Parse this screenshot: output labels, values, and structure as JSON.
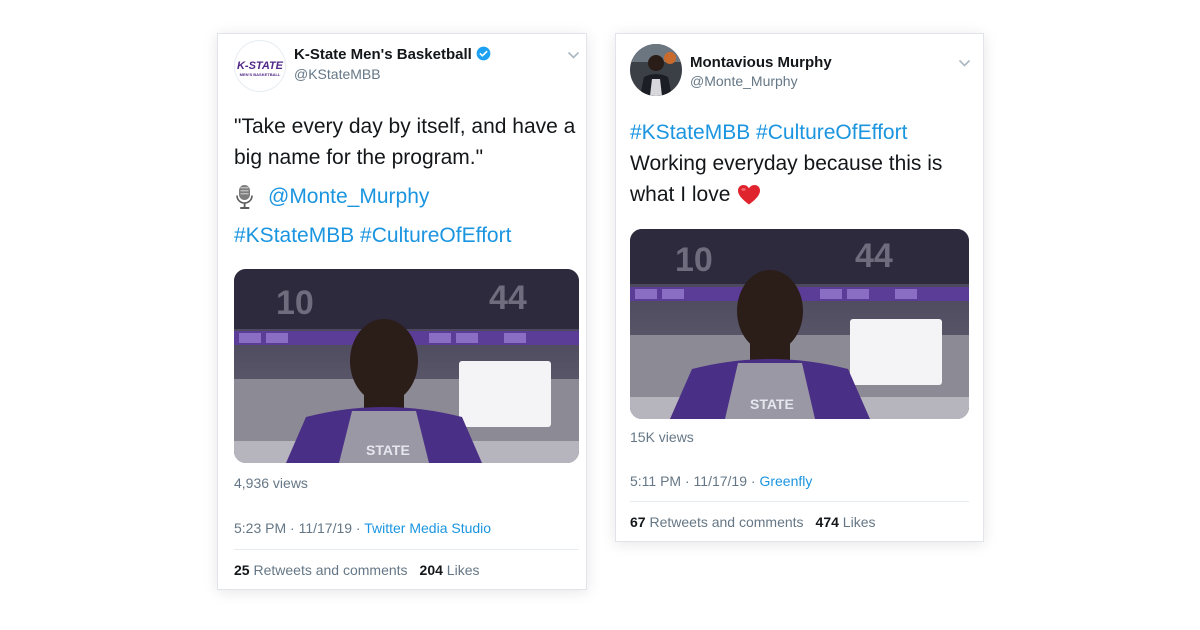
{
  "tweets": [
    {
      "display_name": "K-State Men's Basketball",
      "handle": "@KStateMBB",
      "avatar_text": "K-STATE",
      "avatar_subtext": "MEN'S BASKETBALL",
      "verified": true,
      "text_line1": "\"Take every day by itself, and have a",
      "text_line2": "big name for the program.\"",
      "mention_icon": "microphone-icon",
      "mention": "@Monte_Murphy",
      "hashtags": "#KStateMBB #CultureOfEffort",
      "views": "4,936 views",
      "time": "5:23 PM · 11/17/19 · ",
      "source": "Twitter Media Studio",
      "retweets_count": "25",
      "retweets_label": "Retweets and comments",
      "likes_count": "204",
      "likes_label": "Likes"
    },
    {
      "display_name": "Montavious Murphy",
      "handle": "@Monte_Murphy",
      "verified": false,
      "hashtags": "#KStateMBB #CultureOfEffort",
      "text_line1": "Working everyday because this is",
      "text_line2": "what I love",
      "emoji_icon": "red-heart-icon",
      "views": "15K views",
      "time": "5:11 PM · 11/17/19 · ",
      "source": "Greenfly",
      "retweets_count": "67",
      "retweets_label": "Retweets and comments",
      "likes_count": "474",
      "likes_label": "Likes"
    }
  ],
  "colors": {
    "link": "#1b95e0",
    "muted": "#657786",
    "text": "#14171a",
    "kstate_purple": "#512888"
  }
}
